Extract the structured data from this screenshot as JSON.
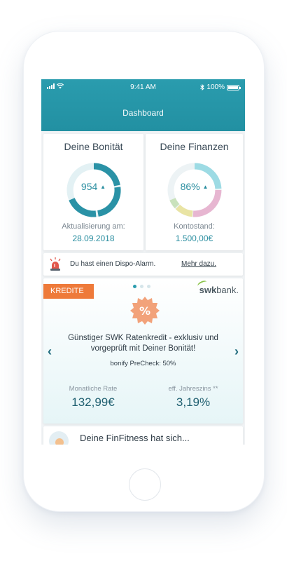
{
  "status": {
    "time": "9:41 AM",
    "battery": "100%",
    "battery_level": 1.0
  },
  "header": {
    "title": "Dashboard"
  },
  "bonitaet": {
    "title": "Deine Bonität",
    "score": "954",
    "update_label": "Aktualisierung am:",
    "update_date": "28.09.2018",
    "color": "#2a92a6"
  },
  "finanzen": {
    "title": "Deine Finanzen",
    "percent": "86%",
    "balance_label": "Kontostand:",
    "balance": "1.500,00€"
  },
  "alarm": {
    "text": "Du hast einen Dispo-Alarm.",
    "link": "Mehr dazu."
  },
  "promo": {
    "tag": "KREDITE",
    "brand_prefix": "swk",
    "brand_suffix": "bank.",
    "carousel_active": 1,
    "carousel_count": 3,
    "title": "Günstiger SWK Ratenkredit - exklusiv und vorgeprüft mit Deiner Bonität!",
    "subtitle": "bonify PreCheck: 50%",
    "rate_label": "Monatliche Rate",
    "rate_value": "132,99€",
    "apr_label": "eff. Jahreszins **",
    "apr_value": "3,19%",
    "accent": "#ee7a3a"
  },
  "finfitness": {
    "text": "Deine FinFitness hat sich..."
  },
  "icons": {
    "prev": "chevron-left-icon",
    "next": "chevron-right-icon",
    "alarm": "siren-icon",
    "badge": "percent-badge-icon"
  }
}
